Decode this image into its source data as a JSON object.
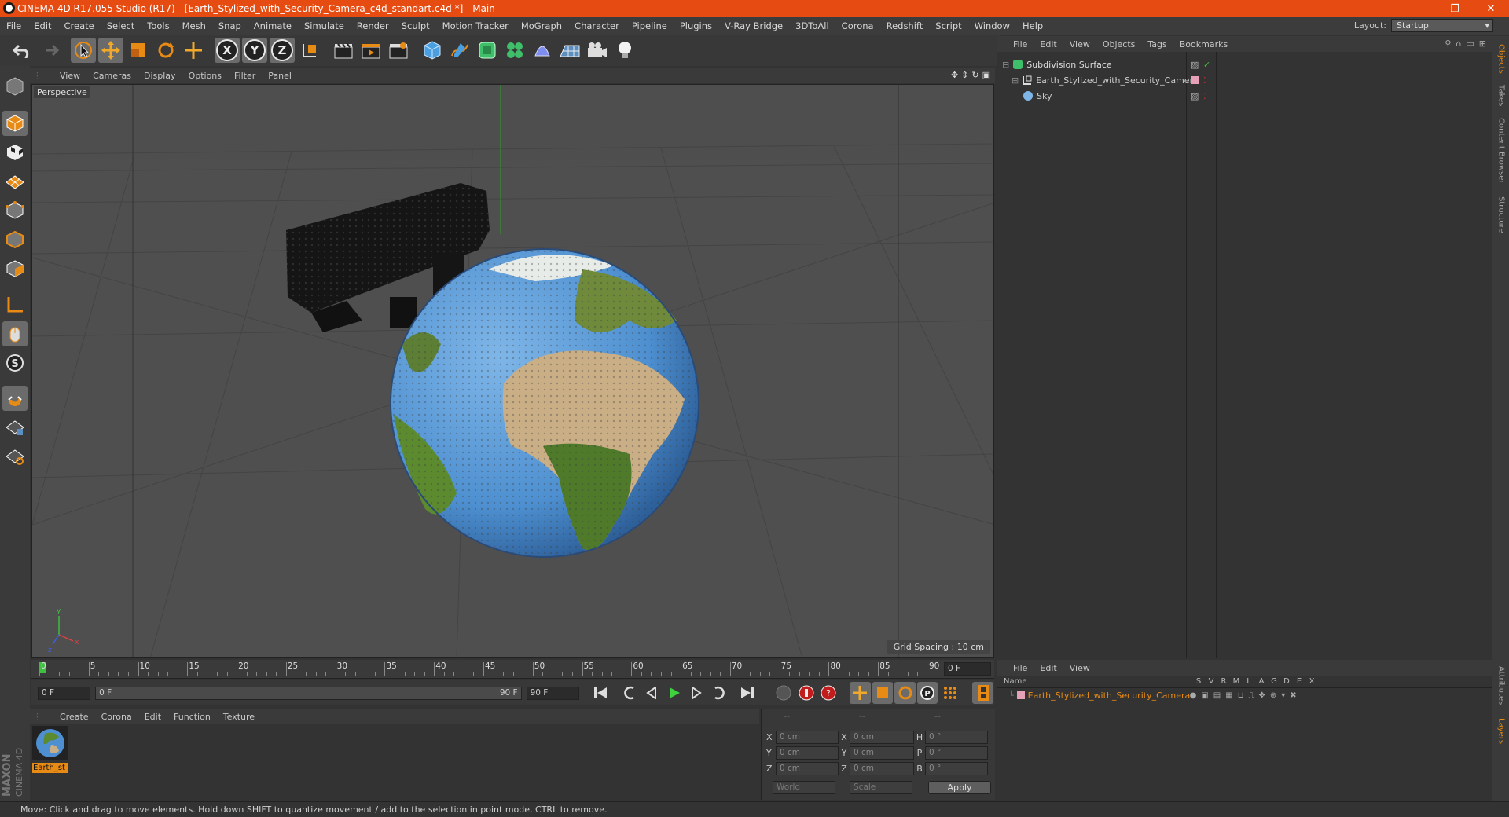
{
  "window": {
    "title": "CINEMA 4D R17.055 Studio (R17) - [Earth_Stylized_with_Security_Camera_c4d_standart.c4d *] - Main",
    "minimize": "—",
    "maximize": "❐",
    "close": "✕"
  },
  "menu": [
    "File",
    "Edit",
    "Create",
    "Select",
    "Tools",
    "Mesh",
    "Snap",
    "Animate",
    "Simulate",
    "Render",
    "Sculpt",
    "Motion Tracker",
    "MoGraph",
    "Character",
    "Pipeline",
    "Plugins",
    "V-Ray Bridge",
    "3DToAll",
    "Corona",
    "Redshift",
    "Script",
    "Window",
    "Help"
  ],
  "layout": {
    "label": "Layout:",
    "value": "Startup"
  },
  "toolbar": {
    "axis_x": "X",
    "axis_y": "Y",
    "axis_z": "Z"
  },
  "viewport": {
    "menu": [
      "View",
      "Cameras",
      "Display",
      "Options",
      "Filter",
      "Panel"
    ],
    "label": "Perspective",
    "grid_spacing": "Grid Spacing : 10 cm"
  },
  "timeline": {
    "ticks": [
      "0",
      "5",
      "10",
      "15",
      "20",
      "25",
      "30",
      "35",
      "40",
      "45",
      "50",
      "55",
      "60",
      "65",
      "70",
      "75",
      "80",
      "85",
      "90"
    ],
    "current_frame": "0 F",
    "start_field": "0 F",
    "range_start": "0 F",
    "range_end": "90 F",
    "end_field": "90 F"
  },
  "material": {
    "menu": [
      "Create",
      "Corona",
      "Edit",
      "Function",
      "Texture"
    ],
    "items": [
      {
        "name": "Earth_st"
      }
    ]
  },
  "coordinates": {
    "headers": [
      "--",
      "--",
      "--"
    ],
    "rows": [
      {
        "a": "X",
        "av": "0 cm",
        "b": "X",
        "bv": "0 cm",
        "c": "H",
        "cv": "0 °"
      },
      {
        "a": "Y",
        "av": "0 cm",
        "b": "Y",
        "bv": "0 cm",
        "c": "P",
        "cv": "0 °"
      },
      {
        "a": "Z",
        "av": "0 cm",
        "b": "Z",
        "bv": "0 cm",
        "c": "B",
        "cv": "0 °"
      }
    ],
    "space": "World",
    "mode": "Scale",
    "apply": "Apply"
  },
  "objects": {
    "menu": [
      "File",
      "Edit",
      "View",
      "Objects",
      "Tags",
      "Bookmarks"
    ],
    "items": [
      {
        "name": "Subdivision Surface"
      },
      {
        "name": "Earth_Stylized_with_Security_Camera"
      },
      {
        "name": "Sky"
      }
    ]
  },
  "layers": {
    "menu": [
      "File",
      "Edit",
      "View"
    ],
    "columns": [
      "Name",
      "S",
      "V",
      "R",
      "M",
      "L",
      "A",
      "G",
      "D",
      "E",
      "X"
    ],
    "items": [
      {
        "name": "Earth_Stylized_with_Security_Camera"
      }
    ]
  },
  "right_tabs": [
    "Objects",
    "Takes",
    "Content Browser",
    "Structure",
    "Attributes",
    "Layers"
  ],
  "brand": {
    "line1": "MAXON",
    "line2": "CINEMA 4D"
  },
  "status": "Move: Click and drag to move elements. Hold down SHIFT to quantize movement / add to the selection in point mode, CTRL to remove.",
  "colors": {
    "accent": "#e64c12",
    "active": "#e88b14"
  }
}
